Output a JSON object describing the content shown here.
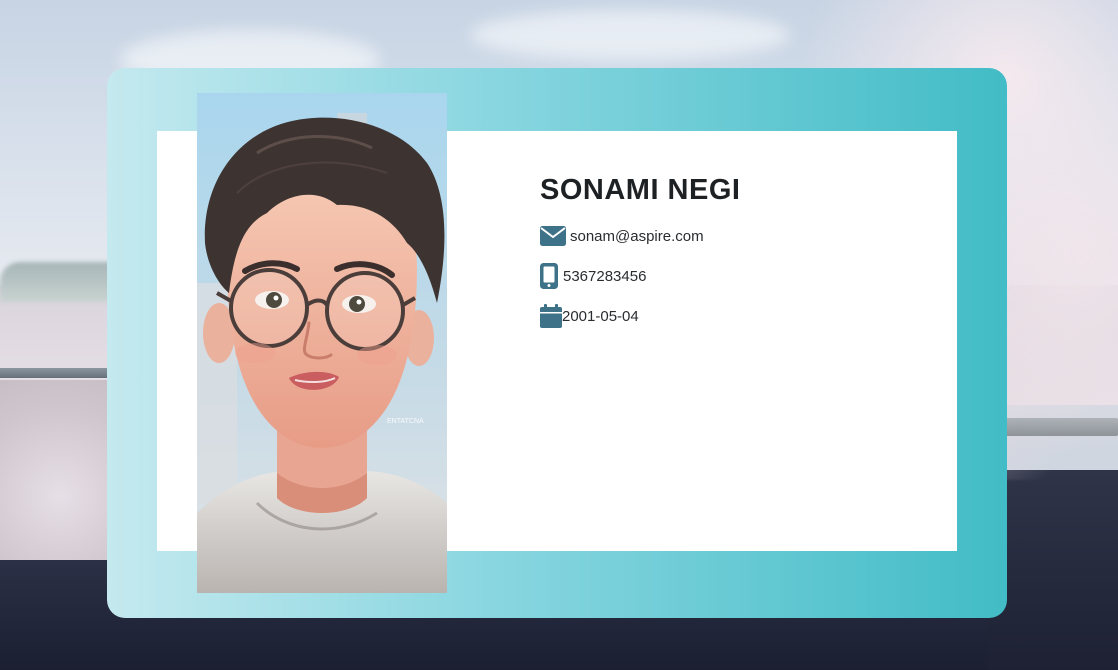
{
  "profile": {
    "name": "SONAMI NEGI",
    "email": "sonam@aspire.com",
    "phone": "5367283456",
    "birthdate": "2001-05-04"
  },
  "icons": {
    "email": "envelope-icon",
    "phone": "mobile-phone-icon",
    "birthdate": "calendar-icon"
  },
  "portrait": {
    "description_tag": "illustrated-portrait",
    "artist_mark": "ENTATCNA"
  },
  "colors": {
    "frame_gradient": [
      "#c4e9ef",
      "#86d5df",
      "#42bcc6"
    ],
    "icon": "#3e7288",
    "name_text": "#1e2124",
    "panel": "#ffffff"
  }
}
